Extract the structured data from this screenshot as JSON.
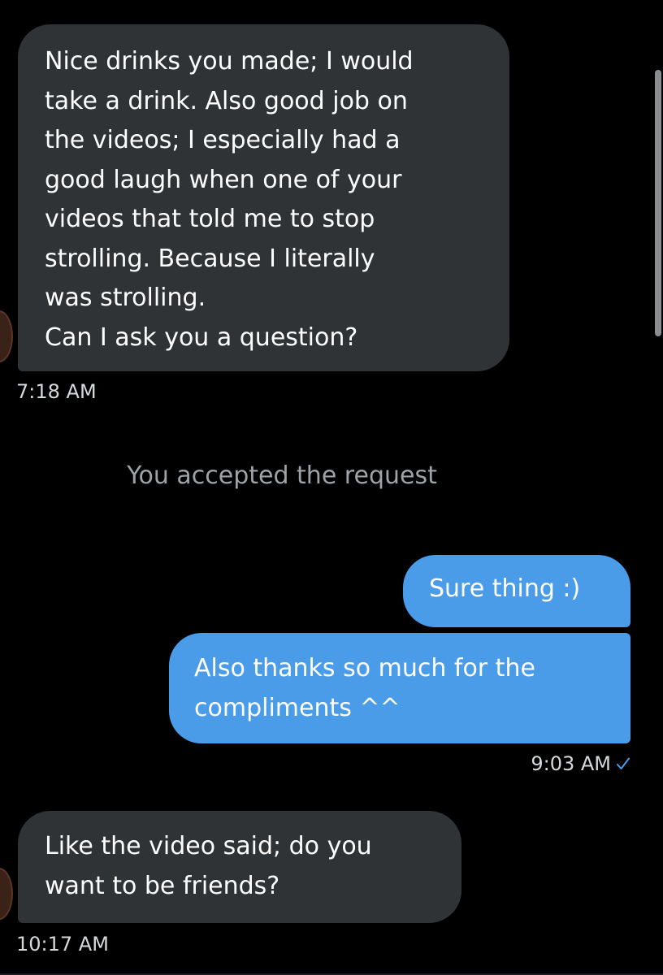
{
  "conversation": {
    "messages": [
      {
        "direction": "incoming",
        "text": "Nice drinks you made; I would\ntake a drink. Also good job on\nthe videos; I especially had a\ngood laugh when one of your\nvideos that told me to stop\nstrolling. Because I literally\nwas strolling.\nCan I ask you a question?",
        "time": "7:18 AM"
      },
      {
        "direction": "system",
        "text": "You accepted the request"
      },
      {
        "direction": "outgoing",
        "text": "Sure thing :)"
      },
      {
        "direction": "outgoing",
        "text": "Also thanks so much for the\ncompliments ^^",
        "time": "9:03 AM",
        "status_icon": "check-icon"
      },
      {
        "direction": "incoming",
        "text": "Like the video said; do you\nwant to be friends?",
        "time": "10:17 AM"
      }
    ]
  },
  "colors": {
    "background": "#000000",
    "incoming_bubble": "#2f3336",
    "outgoing_bubble": "#4a9ce9",
    "timestamp": "#d6d9db",
    "system_text": "#9ea3a8",
    "read_check": "#4a9ce9"
  }
}
